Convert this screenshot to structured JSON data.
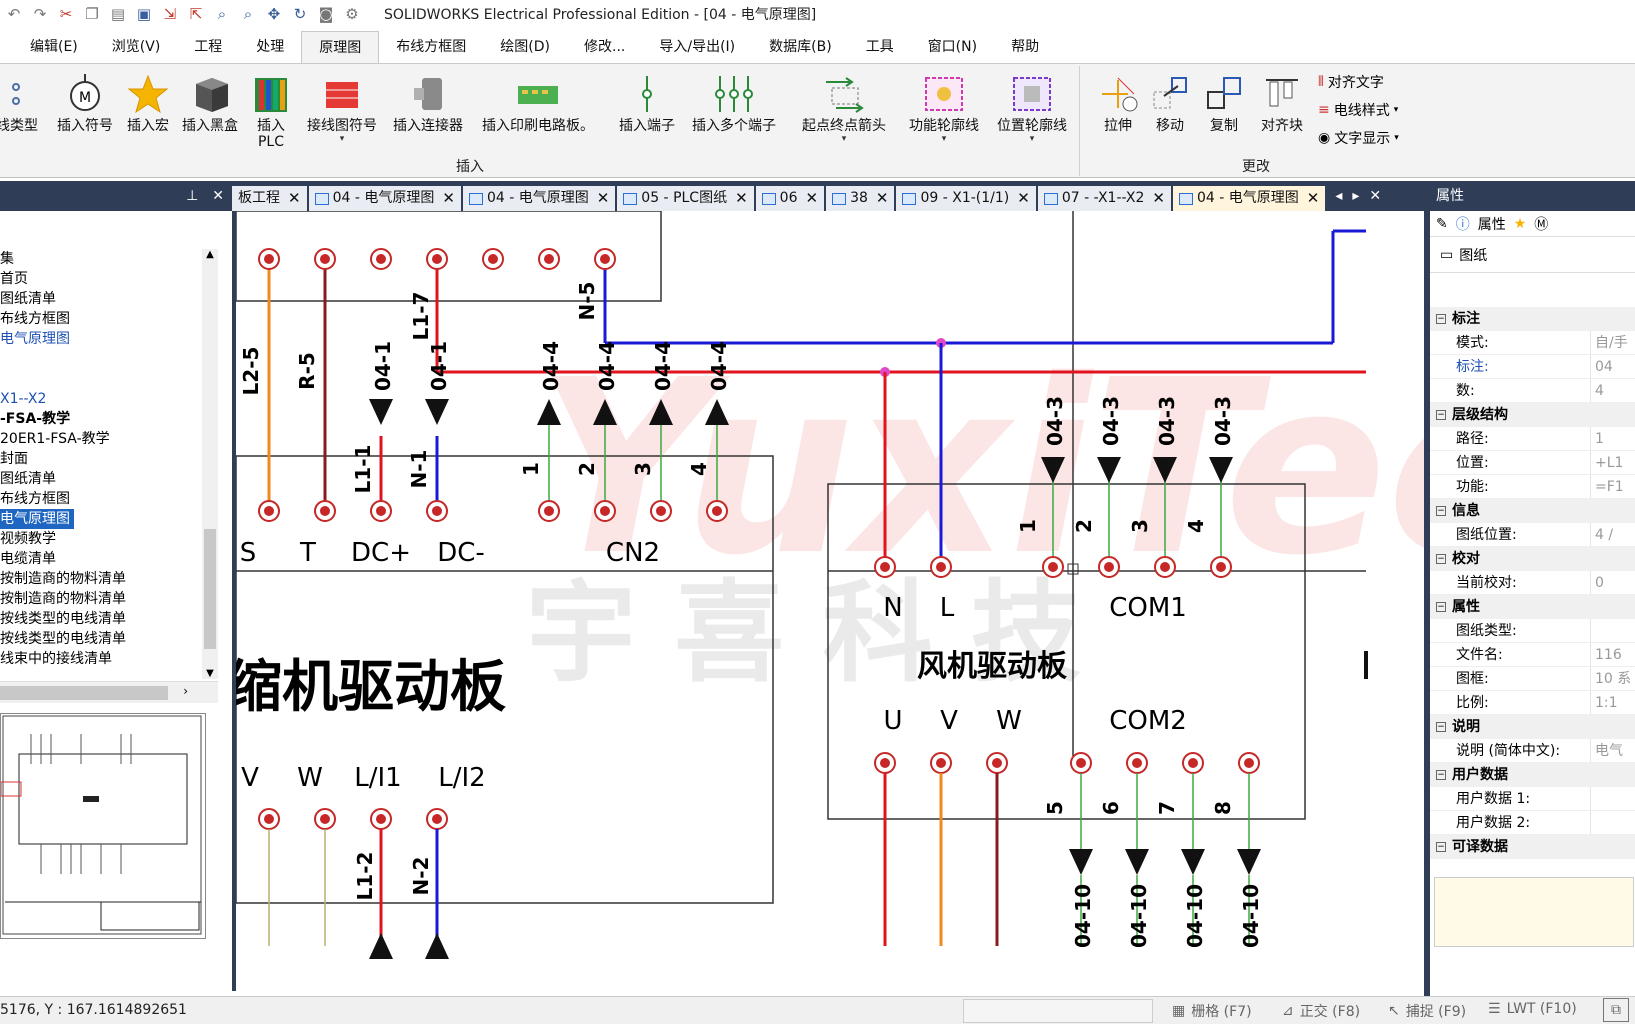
{
  "window": {
    "title": "SOLIDWORKS Electrical Professional Edition - [04 - 电气原理图]"
  },
  "menu": [
    "编辑(E)",
    "浏览(V)",
    "工程",
    "处理",
    "原理图",
    "布线方框图",
    "绘图(D)",
    "修改...",
    "导入/导出(I)",
    "数据库(B)",
    "工具",
    "窗口(N)",
    "帮助"
  ],
  "menu_active": "原理图",
  "ribbon": {
    "insert_group": "插入",
    "modify_group": "更改",
    "buttons": {
      "wire_type": "线类型",
      "insert_symbol": "插入符号",
      "insert_macro": "插入宏",
      "insert_blackbox": "插入黑盒",
      "insert_plc": "插入\nPLC",
      "wiring_symbol": "接线图符号",
      "insert_connector": "插入连接器",
      "insert_pcb": "插入印刷电路板。",
      "insert_terminal": "插入端子",
      "insert_multi_terminal": "插入多个端子",
      "origin_dest_arrow": "起点终点箭头",
      "function_outline": "功能轮廓线",
      "location_outline": "位置轮廓线",
      "stretch": "拉伸",
      "move": "移动",
      "copy": "复制",
      "align_block": "对齐块",
      "align_text": "对齐文字",
      "wire_style": "电线样式",
      "text_display": "文字显示"
    }
  },
  "left_panel": {
    "tree": [
      {
        "text": "集",
        "style": ""
      },
      {
        "text": "首页",
        "style": ""
      },
      {
        "text": "图纸清单",
        "style": ""
      },
      {
        "text": "布线方框图",
        "style": ""
      },
      {
        "text": "电气原理图",
        "style": "blue"
      },
      {
        "text": "",
        "style": ""
      },
      {
        "text": "",
        "style": ""
      },
      {
        "text": "X1--X2",
        "style": "blue"
      },
      {
        "text": "-FSA-教学",
        "style": "bold"
      },
      {
        "text": "20ER1-FSA-教学",
        "style": ""
      },
      {
        "text": "封面",
        "style": ""
      },
      {
        "text": "图纸清单",
        "style": ""
      },
      {
        "text": "布线方框图",
        "style": ""
      },
      {
        "text": "电气原理图",
        "style": "sel"
      },
      {
        "text": "视频教学",
        "style": ""
      },
      {
        "text": "电缆清单",
        "style": ""
      },
      {
        "text": "按制造商的物料清单",
        "style": ""
      },
      {
        "text": "按制造商的物料清单",
        "style": ""
      },
      {
        "text": "按线类型的电线清单",
        "style": ""
      },
      {
        "text": "按线类型的电线清单",
        "style": ""
      },
      {
        "text": "线束中的接线清单",
        "style": ""
      }
    ]
  },
  "tabs": [
    {
      "label": "板工程",
      "active": false
    },
    {
      "label": "04 - 电气原理图",
      "active": false
    },
    {
      "label": "04 - 电气原理图",
      "active": false
    },
    {
      "label": "05 - PLC图纸",
      "active": false
    },
    {
      "label": "06",
      "active": false
    },
    {
      "label": "38",
      "active": false
    },
    {
      "label": "09 - X1-(1/1)",
      "active": false
    },
    {
      "label": "07 - -X1--X2",
      "active": false
    },
    {
      "label": "04 - 电气原理图",
      "active": true
    }
  ],
  "schematic": {
    "watermark_text": "YuxiTech",
    "watermark_cn": "宇 喜 科 技",
    "board_left": {
      "title": "缩机驱动板",
      "top_terminals": [
        "S",
        "T",
        "DC+",
        "DC-",
        "CN2"
      ],
      "bottom_terminals": [
        "V",
        "W",
        "L/I1",
        "L/I2"
      ],
      "wire_labels": [
        "L2-5",
        "R-5",
        "04-1",
        "04-1",
        "L1-7",
        "N-5",
        "04-4",
        "04-4",
        "04-4",
        "04-4",
        "L1-1",
        "N-1",
        "1",
        "2",
        "3",
        "4",
        "L1-2",
        "N-2"
      ]
    },
    "board_right": {
      "title": "风机驱动板",
      "top_terminals": [
        "N",
        "L",
        "COM1"
      ],
      "bottom_terminals": [
        "U",
        "V",
        "W",
        "COM2"
      ],
      "wire_labels": [
        "04-3",
        "04-3",
        "04-3",
        "04-3",
        "1",
        "2",
        "3",
        "4",
        "5",
        "6",
        "7",
        "8",
        "04-10",
        "04-10",
        "04-10",
        "04-10"
      ]
    }
  },
  "right_panel": {
    "title": "属性",
    "tabs": [
      "属性"
    ],
    "sub": "图纸",
    "sections": [
      {
        "name": "标注",
        "rows": [
          {
            "k": "模式:",
            "v": "自/手",
            "blue": false
          },
          {
            "k": "标注:",
            "v": "04",
            "blue": true
          },
          {
            "k": "数:",
            "v": "4",
            "blue": false
          }
        ]
      },
      {
        "name": "层级结构",
        "rows": [
          {
            "k": "路径:",
            "v": "1",
            "blue": false
          },
          {
            "k": "位置:",
            "v": "+L1",
            "blue": false
          },
          {
            "k": "功能:",
            "v": "=F1",
            "blue": false
          }
        ]
      },
      {
        "name": "信息",
        "rows": [
          {
            "k": "图纸位置:",
            "v": "4 /",
            "blue": false
          }
        ]
      },
      {
        "name": "校对",
        "rows": [
          {
            "k": "当前校对:",
            "v": "0",
            "blue": false
          }
        ]
      },
      {
        "name": "属性",
        "rows": [
          {
            "k": "图纸类型:",
            "v": "",
            "blue": false
          },
          {
            "k": "文件名:",
            "v": "116",
            "blue": false
          },
          {
            "k": "图框:",
            "v": "10 系",
            "blue": false
          },
          {
            "k": "比例:",
            "v": "1:1",
            "blue": false
          }
        ]
      },
      {
        "name": "说明",
        "rows": [
          {
            "k": "说明 (简体中文):",
            "v": "电气",
            "blue": false
          }
        ]
      },
      {
        "name": "用户数据",
        "rows": [
          {
            "k": "用户数据 1:",
            "v": "",
            "blue": false
          },
          {
            "k": "用户数据 2:",
            "v": "",
            "blue": false
          }
        ]
      },
      {
        "name": "可译数据",
        "rows": []
      }
    ]
  },
  "status": {
    "coord": "5176, Y : 167.1614892651",
    "grid": "栅格 (F7)",
    "ortho": "正交 (F8)",
    "snap": "捕捉 (F9)",
    "lwt": "LWT (F10)"
  },
  "colors": {
    "accent_dark": "#2f3d57",
    "wire_red": "#e0141e",
    "wire_blue": "#1a1ad6",
    "wire_orange": "#f08a1a",
    "wire_darkred": "#8b1a1a",
    "wire_green": "#3ca83c"
  }
}
